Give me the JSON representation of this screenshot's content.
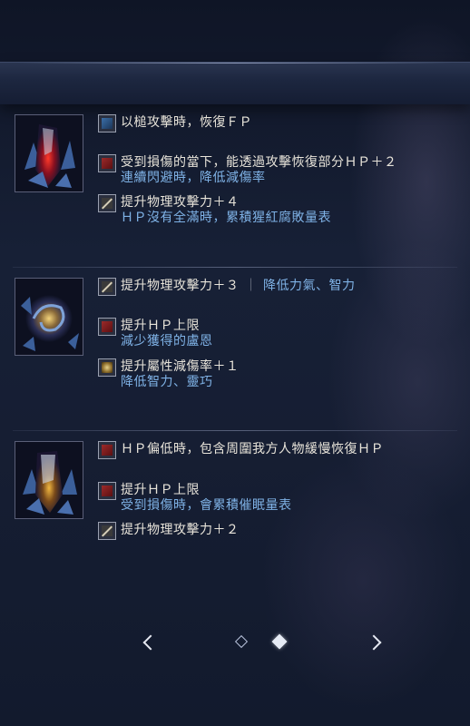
{
  "groups": [
    {
      "gem_icon": "red-crystal-icon",
      "lines": [
        {
          "icon": "blue-square-icon",
          "text": "以槌攻擊時，恢復ＦＰ",
          "sub": ""
        },
        {
          "icon": "red-square-icon",
          "text": "受到損傷的當下，能透過攻擊恢復部分ＨＰ＋２",
          "sub": "連續閃避時，降低減傷率"
        },
        {
          "icon": "sword-icon",
          "text": "提升物理攻擊力＋４",
          "sub": "ＨＰ沒有全滿時，累積猩紅腐敗量表"
        }
      ]
    },
    {
      "gem_icon": "swirl-orb-icon",
      "lines": [
        {
          "icon": "sword-icon",
          "text": "提升物理攻擊力＋３",
          "sep": "｜",
          "inline": "降低力氣、智力",
          "sub": ""
        },
        {
          "icon": "red-square-icon",
          "text": "提升ＨＰ上限",
          "sub": "減少獲得的盧恩"
        },
        {
          "icon": "element-icon",
          "text": "提升屬性減傷率＋１",
          "sub": "降低智力、靈巧"
        }
      ]
    },
    {
      "gem_icon": "gold-crystal-icon",
      "lines": [
        {
          "icon": "red-square-icon",
          "text": "ＨＰ偏低時，包含周圍我方人物緩慢恢復ＨＰ",
          "sub": ""
        },
        {
          "icon": "red-square-icon",
          "text": "提升ＨＰ上限",
          "sub": "受到損傷時，會累積催眠量表"
        },
        {
          "icon": "sword-icon",
          "text": "提升物理攻擊力＋２",
          "sub": ""
        }
      ]
    }
  ],
  "pagination": {
    "current_page": 2,
    "total_pages": 2
  },
  "colors": {
    "primary_text": "#e8e4da",
    "secondary_text": "#7fb2e6",
    "background": "#131a2c"
  }
}
